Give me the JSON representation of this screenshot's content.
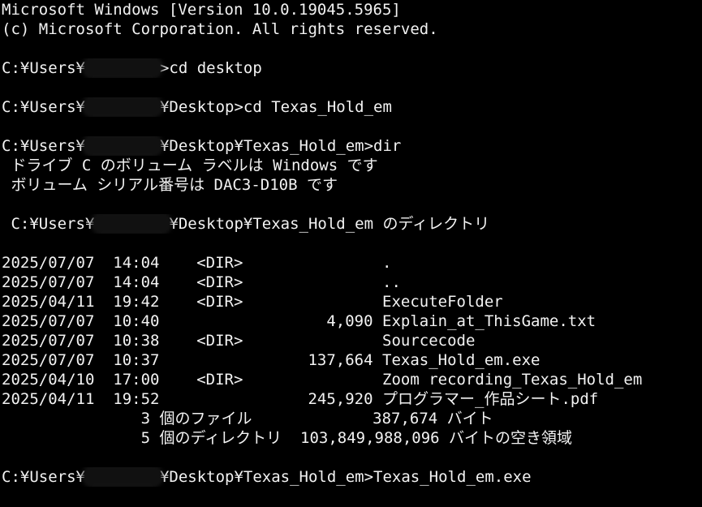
{
  "window": {
    "lines": {
      "version": "Microsoft Windows [Version 10.0.19045.5965]",
      "copyright": "(c) Microsoft Corporation. All rights reserved."
    }
  },
  "prompts": [
    {
      "prefix": "C:¥Users¥",
      "suffix": ">cd desktop"
    },
    {
      "prefix": "C:¥Users¥",
      "suffix": "¥Desktop>cd Texas_Hold_em"
    },
    {
      "prefix": "C:¥Users¥",
      "suffix": "¥Desktop¥Texas_Hold_em>dir"
    }
  ],
  "volume": {
    "label_line": " ドライブ C のボリューム ラベルは Windows です",
    "serial_line": " ボリューム シリアル番号は DAC3-D10B です"
  },
  "directory": {
    "prefix": " C:¥Users¥",
    "suffix": "¥Desktop¥Texas_Hold_em のディレクトリ"
  },
  "listing": [
    {
      "date": "2025/07/07",
      "time": "14:04",
      "type": "<DIR>",
      "size": "",
      "name": "."
    },
    {
      "date": "2025/07/07",
      "time": "14:04",
      "type": "<DIR>",
      "size": "",
      "name": ".."
    },
    {
      "date": "2025/04/11",
      "time": "19:42",
      "type": "<DIR>",
      "size": "",
      "name": "ExecuteFolder"
    },
    {
      "date": "2025/07/07",
      "time": "10:40",
      "type": "",
      "size": "4,090",
      "name": "Explain_at_ThisGame.txt"
    },
    {
      "date": "2025/07/07",
      "time": "10:38",
      "type": "<DIR>",
      "size": "",
      "name": "Sourcecode"
    },
    {
      "date": "2025/07/07",
      "time": "10:37",
      "type": "",
      "size": "137,664",
      "name": "Texas_Hold_em.exe"
    },
    {
      "date": "2025/04/10",
      "time": "17:00",
      "type": "<DIR>",
      "size": "",
      "name": "Zoom recording_Texas_Hold_em"
    },
    {
      "date": "2025/04/11",
      "time": "19:52",
      "type": "",
      "size": "245,920",
      "name": "プログラマー_作品シート.pdf"
    }
  ],
  "summary": {
    "files_line": "               3 個のファイル             387,674 バイト",
    "dirs_line": "               5 個のディレクトリ  103,849,988,096 バイトの空き領域"
  },
  "last_prompt": {
    "prefix": "C:¥Users¥",
    "suffix": "¥Desktop¥Texas_Hold_em>Texas_Hold_em.exe"
  }
}
